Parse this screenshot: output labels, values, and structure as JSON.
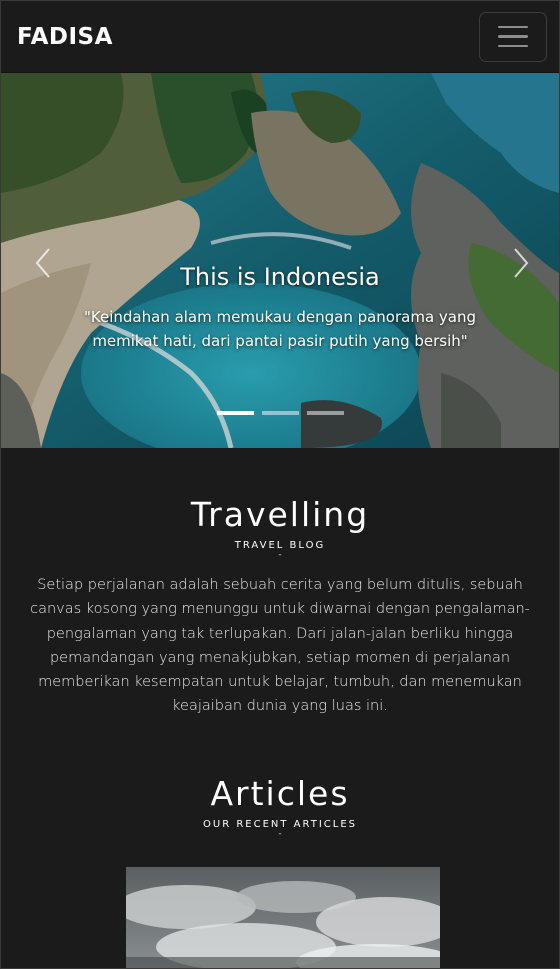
{
  "navbar": {
    "brand": "FADISA",
    "toggler_icon": "hamburger-icon"
  },
  "hero": {
    "title": "This is Indonesia",
    "text": "\"Keindahan alam memukau dengan panorama yang memikat hati, dari pantai pasir putih yang bersih\"",
    "prev_icon": "chevron-left-icon",
    "next_icon": "chevron-right-icon",
    "slides": 3,
    "active_slide": 1
  },
  "travel": {
    "title": "Travelling",
    "subtitle": "TRAVEL BLOG",
    "dash": "-",
    "text": "Setiap perjalanan adalah sebuah cerita yang belum ditulis, sebuah canvas kosong yang menunggu untuk diwarnai dengan pengalaman-pengalaman yang tak terlupakan. Dari jalan-jalan berliku hingga pemandangan yang menakjubkan, setiap momen di perjalanan memberikan kesempatan untuk belajar, tumbuh, dan menemukan keajaiban dunia yang luas ini."
  },
  "articles": {
    "title": "Articles",
    "subtitle": "OUR RECENT ARTICLES",
    "dash": "-"
  },
  "colors": {
    "background": "#1b1b1c",
    "text": "#ffffff"
  }
}
